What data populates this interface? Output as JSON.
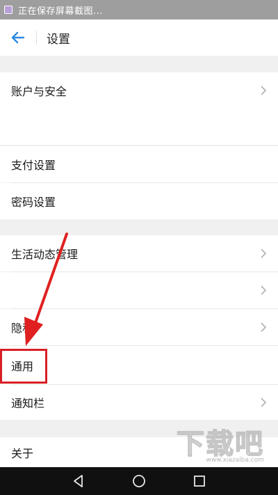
{
  "status_bar": {
    "text": "正在保存屏幕截图..."
  },
  "header": {
    "title": "设置"
  },
  "menu": {
    "account_security": "账户与安全",
    "payment_settings": "支付设置",
    "password_settings": "密码设置",
    "moments_management": "生活动态管理",
    "privacy": "隐私",
    "general": "通用",
    "notification_bar": "通知栏",
    "about": "关于"
  },
  "watermark": {
    "logo": "下载吧",
    "url": "www.xiazaiba.com"
  },
  "colors": {
    "accent": "#d91f26",
    "back_arrow": "#2a8ae0"
  },
  "icons": [
    "back-arrow-icon",
    "chevron-right-icon",
    "nav-back-icon",
    "nav-home-icon",
    "nav-recent-icon",
    "screenshot-icon"
  ]
}
